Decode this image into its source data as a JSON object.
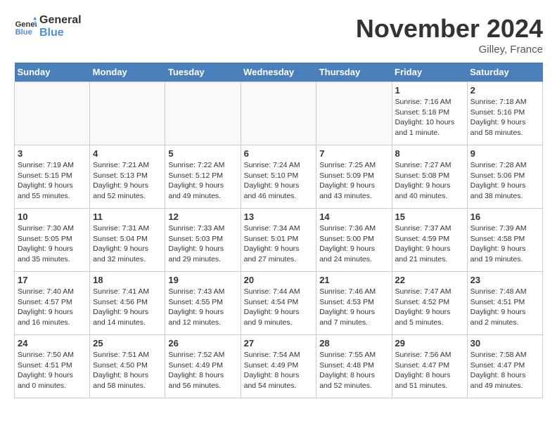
{
  "header": {
    "logo_line1": "General",
    "logo_line2": "Blue",
    "month_title": "November 2024",
    "location": "Gilley, France"
  },
  "weekdays": [
    "Sunday",
    "Monday",
    "Tuesday",
    "Wednesday",
    "Thursday",
    "Friday",
    "Saturday"
  ],
  "weeks": [
    [
      {
        "day": "",
        "info": ""
      },
      {
        "day": "",
        "info": ""
      },
      {
        "day": "",
        "info": ""
      },
      {
        "day": "",
        "info": ""
      },
      {
        "day": "",
        "info": ""
      },
      {
        "day": "1",
        "info": "Sunrise: 7:16 AM\nSunset: 5:18 PM\nDaylight: 10 hours and 1 minute."
      },
      {
        "day": "2",
        "info": "Sunrise: 7:18 AM\nSunset: 5:16 PM\nDaylight: 9 hours and 58 minutes."
      }
    ],
    [
      {
        "day": "3",
        "info": "Sunrise: 7:19 AM\nSunset: 5:15 PM\nDaylight: 9 hours and 55 minutes."
      },
      {
        "day": "4",
        "info": "Sunrise: 7:21 AM\nSunset: 5:13 PM\nDaylight: 9 hours and 52 minutes."
      },
      {
        "day": "5",
        "info": "Sunrise: 7:22 AM\nSunset: 5:12 PM\nDaylight: 9 hours and 49 minutes."
      },
      {
        "day": "6",
        "info": "Sunrise: 7:24 AM\nSunset: 5:10 PM\nDaylight: 9 hours and 46 minutes."
      },
      {
        "day": "7",
        "info": "Sunrise: 7:25 AM\nSunset: 5:09 PM\nDaylight: 9 hours and 43 minutes."
      },
      {
        "day": "8",
        "info": "Sunrise: 7:27 AM\nSunset: 5:08 PM\nDaylight: 9 hours and 40 minutes."
      },
      {
        "day": "9",
        "info": "Sunrise: 7:28 AM\nSunset: 5:06 PM\nDaylight: 9 hours and 38 minutes."
      }
    ],
    [
      {
        "day": "10",
        "info": "Sunrise: 7:30 AM\nSunset: 5:05 PM\nDaylight: 9 hours and 35 minutes."
      },
      {
        "day": "11",
        "info": "Sunrise: 7:31 AM\nSunset: 5:04 PM\nDaylight: 9 hours and 32 minutes."
      },
      {
        "day": "12",
        "info": "Sunrise: 7:33 AM\nSunset: 5:03 PM\nDaylight: 9 hours and 29 minutes."
      },
      {
        "day": "13",
        "info": "Sunrise: 7:34 AM\nSunset: 5:01 PM\nDaylight: 9 hours and 27 minutes."
      },
      {
        "day": "14",
        "info": "Sunrise: 7:36 AM\nSunset: 5:00 PM\nDaylight: 9 hours and 24 minutes."
      },
      {
        "day": "15",
        "info": "Sunrise: 7:37 AM\nSunset: 4:59 PM\nDaylight: 9 hours and 21 minutes."
      },
      {
        "day": "16",
        "info": "Sunrise: 7:39 AM\nSunset: 4:58 PM\nDaylight: 9 hours and 19 minutes."
      }
    ],
    [
      {
        "day": "17",
        "info": "Sunrise: 7:40 AM\nSunset: 4:57 PM\nDaylight: 9 hours and 16 minutes."
      },
      {
        "day": "18",
        "info": "Sunrise: 7:41 AM\nSunset: 4:56 PM\nDaylight: 9 hours and 14 minutes."
      },
      {
        "day": "19",
        "info": "Sunrise: 7:43 AM\nSunset: 4:55 PM\nDaylight: 9 hours and 12 minutes."
      },
      {
        "day": "20",
        "info": "Sunrise: 7:44 AM\nSunset: 4:54 PM\nDaylight: 9 hours and 9 minutes."
      },
      {
        "day": "21",
        "info": "Sunrise: 7:46 AM\nSunset: 4:53 PM\nDaylight: 9 hours and 7 minutes."
      },
      {
        "day": "22",
        "info": "Sunrise: 7:47 AM\nSunset: 4:52 PM\nDaylight: 9 hours and 5 minutes."
      },
      {
        "day": "23",
        "info": "Sunrise: 7:48 AM\nSunset: 4:51 PM\nDaylight: 9 hours and 2 minutes."
      }
    ],
    [
      {
        "day": "24",
        "info": "Sunrise: 7:50 AM\nSunset: 4:51 PM\nDaylight: 9 hours and 0 minutes."
      },
      {
        "day": "25",
        "info": "Sunrise: 7:51 AM\nSunset: 4:50 PM\nDaylight: 8 hours and 58 minutes."
      },
      {
        "day": "26",
        "info": "Sunrise: 7:52 AM\nSunset: 4:49 PM\nDaylight: 8 hours and 56 minutes."
      },
      {
        "day": "27",
        "info": "Sunrise: 7:54 AM\nSunset: 4:49 PM\nDaylight: 8 hours and 54 minutes."
      },
      {
        "day": "28",
        "info": "Sunrise: 7:55 AM\nSunset: 4:48 PM\nDaylight: 8 hours and 52 minutes."
      },
      {
        "day": "29",
        "info": "Sunrise: 7:56 AM\nSunset: 4:47 PM\nDaylight: 8 hours and 51 minutes."
      },
      {
        "day": "30",
        "info": "Sunrise: 7:58 AM\nSunset: 4:47 PM\nDaylight: 8 hours and 49 minutes."
      }
    ]
  ]
}
